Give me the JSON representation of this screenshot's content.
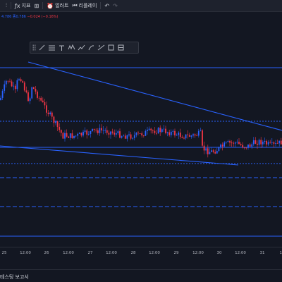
{
  "toolbar": {
    "indicators_label": "지표",
    "alert_label": "얼러트",
    "replay_label": "리플레이"
  },
  "ohlc": {
    "text_prefix": "4.786",
    "close_label": "종0.786",
    "change_text": "−0.024 (−0.16%)"
  },
  "x_axis": {
    "ticks": [
      "25",
      "12:00",
      "26",
      "12:00",
      "27",
      "12:00",
      "28",
      "12:00",
      "29",
      "12:00",
      "30",
      "12:00",
      "31",
      "12"
    ]
  },
  "bottom_panel": {
    "tab_label": "테스팅 보고서"
  },
  "colors": {
    "background": "#131722",
    "up_candle": "#2962ff",
    "down_candle": "#f23645",
    "trendline": "#2962ff"
  },
  "drawing_toolbar": {
    "icons": [
      "drag-handle-icon",
      "trendline-icon",
      "fib-icon",
      "text-icon",
      "pattern-icon",
      "prediction-icon",
      "brush-icon",
      "measure-icon",
      "rectangle-icon",
      "magnet-icon"
    ]
  }
}
